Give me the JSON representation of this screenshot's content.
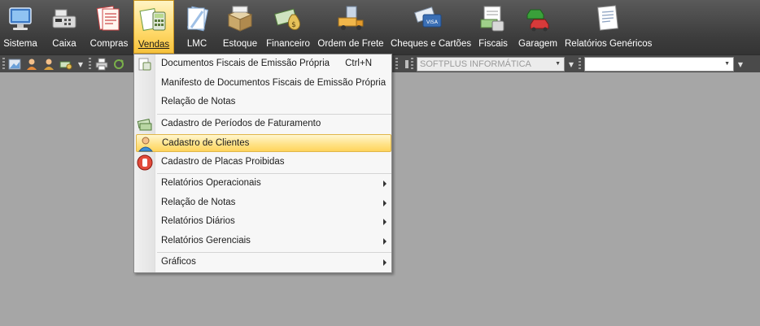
{
  "ribbon": {
    "items": [
      {
        "label": "Sistema",
        "icon": "computer-icon"
      },
      {
        "label": "Caixa",
        "icon": "cash-register-icon"
      },
      {
        "label": "Compras",
        "icon": "purchases-icon"
      },
      {
        "label": "Vendas",
        "icon": "sales-calculator-icon",
        "active": true
      },
      {
        "label": "LMC",
        "icon": "document-icon"
      },
      {
        "label": "Estoque",
        "icon": "box-icon"
      },
      {
        "label": "Financeiro",
        "icon": "money-bag-icon"
      },
      {
        "label": "Ordem de Frete",
        "icon": "truck-icon"
      },
      {
        "label": "Cheques e Cartões",
        "icon": "card-icon"
      },
      {
        "label": "Fiscais",
        "icon": "tax-document-icon"
      },
      {
        "label": "Garagem",
        "icon": "cars-icon"
      },
      {
        "label": "Relatórios Genéricos",
        "icon": "report-icon"
      }
    ]
  },
  "toolbar": {
    "company_combo": "SOFTPLUS INFORMÁTICA",
    "search_combo": ""
  },
  "menu": {
    "items": [
      {
        "label": "Documentos Fiscais de Emissão Própria",
        "shortcut": "Ctrl+N",
        "icon": "fiscal-doc-icon"
      },
      {
        "label": "Manifesto de Documentos Fiscais de Emissão Própria"
      },
      {
        "label": "Relação de Notas"
      },
      {
        "label": "Cadastro de Períodos de Faturamento",
        "icon": "money-stack-icon"
      },
      {
        "label": "Cadastro de Clientes",
        "icon": "client-icon",
        "highlighted": true
      },
      {
        "label": "Cadastro de Placas Proibidas",
        "icon": "stop-hand-icon"
      },
      {
        "label": "Relatórios Operacionais",
        "submenu": true
      },
      {
        "label": "Relação de Notas",
        "submenu": true
      },
      {
        "label": "Relatórios Diários",
        "submenu": true
      },
      {
        "label": "Relatórios Gerenciais",
        "submenu": true
      },
      {
        "label": "Gráficos",
        "submenu": true
      }
    ]
  },
  "colors": {
    "ribbon_bg": "#3c3c3c",
    "workspace_bg": "#a6a6a6",
    "highlight": "#ffd96a"
  }
}
